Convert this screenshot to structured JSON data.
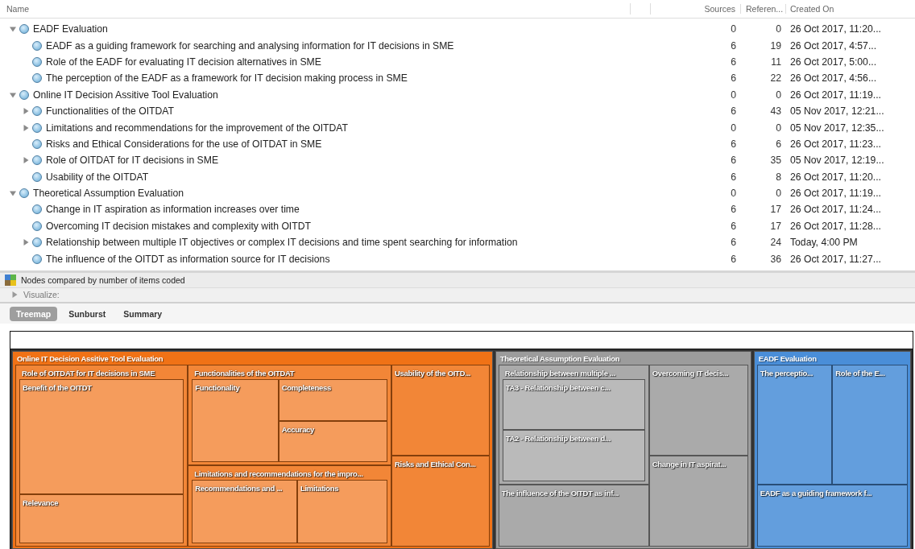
{
  "table": {
    "columns": [
      "Name",
      "Sources",
      "Referen...",
      "Created On"
    ],
    "nodes": [
      {
        "name": "EADF Evaluation",
        "sources": "0",
        "references": "0",
        "created": "26 Oct 2017, 11:20...",
        "kind": "branch",
        "expanded": true,
        "children": [
          {
            "name": "EADF as a guiding framework for searching and analysing information for IT decisions in SME",
            "sources": "6",
            "references": "19",
            "created": "26 Oct 2017, 4:57...",
            "kind": "leaf"
          },
          {
            "name": "Role of the EADF for evaluating IT decision alternatives in SME",
            "sources": "6",
            "references": "11",
            "created": "26 Oct 2017, 5:00...",
            "kind": "leaf"
          },
          {
            "name": "The perception of the EADF as a framework for IT decision making process in SME",
            "sources": "6",
            "references": "22",
            "created": "26 Oct 2017, 4:56...",
            "kind": "leaf"
          }
        ]
      },
      {
        "name": "Online IT Decision Assitive Tool Evaluation",
        "sources": "0",
        "references": "0",
        "created": "26 Oct 2017, 11:19...",
        "kind": "branch",
        "expanded": true,
        "children": [
          {
            "name": "Functionalities of the OITDAT",
            "sources": "6",
            "references": "43",
            "created": "05 Nov 2017, 12:21...",
            "kind": "branch",
            "expanded": false
          },
          {
            "name": "Limitations and recommendations for the improvement of the OITDAT",
            "sources": "0",
            "references": "0",
            "created": "05 Nov 2017, 12:35...",
            "kind": "branch",
            "expanded": false
          },
          {
            "name": "Risks and Ethical Considerations for the use of OITDAT in SME",
            "sources": "6",
            "references": "6",
            "created": "26 Oct 2017, 11:23...",
            "kind": "leaf"
          },
          {
            "name": "Role of OITDAT for IT decisions in SME",
            "sources": "6",
            "references": "35",
            "created": "05 Nov 2017, 12:19...",
            "kind": "branch",
            "expanded": false
          },
          {
            "name": "Usability of the OITDAT",
            "sources": "6",
            "references": "8",
            "created": "26 Oct 2017, 11:20...",
            "kind": "leaf"
          }
        ]
      },
      {
        "name": "Theoretical Assumption Evaluation",
        "sources": "0",
        "references": "0",
        "created": "26 Oct 2017, 11:19...",
        "kind": "branch",
        "expanded": true,
        "children": [
          {
            "name": "Change in IT aspiration as information increases over time",
            "sources": "6",
            "references": "17",
            "created": "26 Oct 2017, 11:24...",
            "kind": "leaf"
          },
          {
            "name": "Overcoming IT decision mistakes and complexity with OITDT",
            "sources": "6",
            "references": "17",
            "created": "26 Oct 2017, 11:28...",
            "kind": "leaf"
          },
          {
            "name": "Relationship between multiple IT objectives or complex IT decisions and time spent searching for information",
            "sources": "6",
            "references": "24",
            "created": "Today, 4:00 PM",
            "kind": "branch",
            "expanded": false
          },
          {
            "name": "The influence of the OITDT as information source for IT decisions",
            "sources": "6",
            "references": "36",
            "created": "26 Oct 2017, 11:27...",
            "kind": "leaf"
          }
        ]
      }
    ]
  },
  "chart_caption": "Nodes compared by number of items coded",
  "visualize": {
    "label": "Visualize:",
    "expanded": false
  },
  "tabs": [
    {
      "label": "Treemap",
      "selected": true
    },
    {
      "label": "Sunburst",
      "selected": false
    },
    {
      "label": "Summary",
      "selected": false
    }
  ],
  "treemap": {
    "groups": [
      {
        "title": "Online IT Decision Assitive Tool Evaluation",
        "color": "#f07216",
        "children": [
          {
            "title": "Role of OITDAT for IT decisions in SME",
            "children": [
              {
                "title": "Benefit of the OITDT"
              },
              {
                "title": "Relevance"
              }
            ]
          },
          {
            "title": "Functionalities of the OITDAT",
            "children": [
              {
                "title": "Functionality"
              },
              {
                "title": "Completeness"
              },
              {
                "title": "Accuracy"
              }
            ]
          },
          {
            "title": "Limitations and recommendations for the impro...",
            "children": [
              {
                "title": "Recommendations and ..."
              },
              {
                "title": "Limitations"
              }
            ]
          },
          {
            "title": "Usability of the OITD..."
          },
          {
            "title": "Risks and Ethical Con..."
          }
        ]
      },
      {
        "title": "Theoretical Assumption Evaluation",
        "color": "#9c9c9c",
        "children": [
          {
            "title": "Relationship between multiple ...",
            "children": [
              {
                "title": "TA3 - Relationship between c..."
              },
              {
                "title": "TA2 - Relationship between d..."
              }
            ]
          },
          {
            "title": "The influence of the OITDT as inf..."
          },
          {
            "title": "Overcoming IT decis..."
          },
          {
            "title": "Change in IT aspirat..."
          }
        ]
      },
      {
        "title": "EADF Evaluation",
        "color": "#4a8ed8",
        "children": [
          {
            "title": "The perceptio..."
          },
          {
            "title": "Role of the E..."
          },
          {
            "title": "EADF as a guiding framework f..."
          }
        ]
      }
    ]
  }
}
